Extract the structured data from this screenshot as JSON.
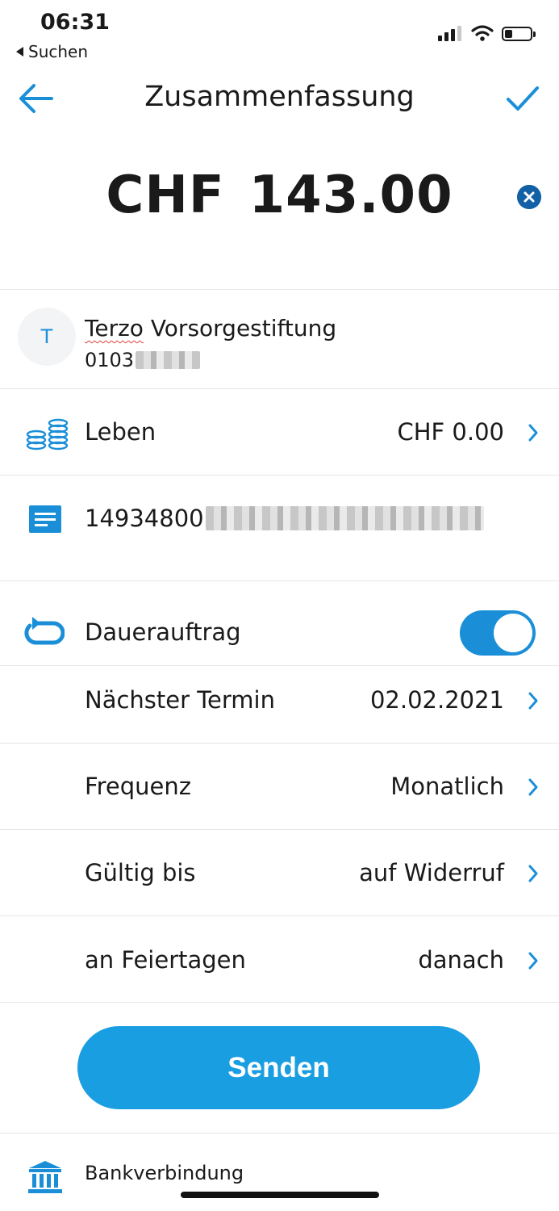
{
  "status_bar": {
    "time": "06:31",
    "back_app": "Suchen"
  },
  "nav": {
    "title": "Zusammenfassung"
  },
  "amount": {
    "currency": "CHF",
    "value": "143.00"
  },
  "recipient": {
    "initial": "T",
    "name_part1": "Terzo",
    "name_part2": " Vorsorgestiftung",
    "account_visible": "0103"
  },
  "rows": {
    "account_type": {
      "label": "Leben",
      "value": "CHF 0.00"
    },
    "reference": {
      "visible": "14934800"
    },
    "standing_order": {
      "label": "Dauerauftrag",
      "enabled": true
    },
    "next_date": {
      "label": "Nächster Termin",
      "value": "02.02.2021"
    },
    "frequency": {
      "label": "Frequenz",
      "value": "Monatlich"
    },
    "valid_until": {
      "label": "Gültig bis",
      "value": "auf Widerruf"
    },
    "holidays": {
      "label": "an Feiertagen",
      "value": "danach"
    }
  },
  "actions": {
    "send_label": "Senden"
  },
  "footer": {
    "bank_label": "Bankverbindung"
  },
  "colors": {
    "accent": "#1a9ee2",
    "accent_dark": "#1260a6",
    "text": "#1a1a1a",
    "divider": "#e6e6e6"
  }
}
